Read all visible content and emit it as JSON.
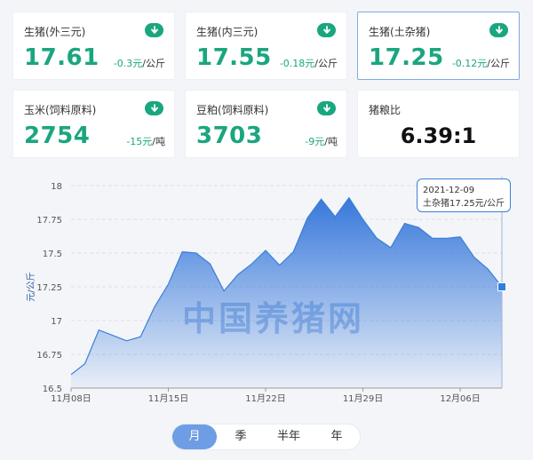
{
  "cards": [
    {
      "label": "生猪(外三元)",
      "value": "17.61",
      "change": "-0.3元",
      "unit": "/公斤",
      "trend": "down"
    },
    {
      "label": "生猪(内三元)",
      "value": "17.55",
      "change": "-0.18元",
      "unit": "/公斤",
      "trend": "down"
    },
    {
      "label": "生猪(土杂猪)",
      "value": "17.25",
      "change": "-0.12元",
      "unit": "/公斤",
      "trend": "down"
    },
    {
      "label": "玉米(饲料原料)",
      "value": "2754",
      "change": "-15元",
      "unit": "/吨",
      "trend": "down"
    },
    {
      "label": "豆粕(饲料原料)",
      "value": "3703",
      "change": "-9元",
      "unit": "/吨",
      "trend": "down"
    },
    {
      "label": "猪粮比",
      "value": "6.39:1"
    }
  ],
  "tooltip": {
    "date": "2021-12-09",
    "text": "土杂猪17.25元/公斤"
  },
  "watermark": "中国养猪网",
  "periods": [
    {
      "label": "月",
      "active": true
    },
    {
      "label": "季",
      "active": false
    },
    {
      "label": "半年",
      "active": false
    },
    {
      "label": "年",
      "active": false
    }
  ],
  "colors": {
    "accent": "#1aa67f",
    "line": "#3b7fd6",
    "marker": "#2f7ee0"
  },
  "chart_data": {
    "type": "area",
    "ylabel": "元/公斤",
    "ylim": [
      16.5,
      18
    ],
    "yticks": [
      "16.5",
      "16.75",
      "17",
      "17.25",
      "17.5",
      "17.75",
      "18"
    ],
    "xtick_labels": [
      "11月08日",
      "11月15日",
      "11月22日",
      "11月29日",
      "12月06日"
    ],
    "grid": true,
    "x": [
      "2021-11-08",
      "2021-11-09",
      "2021-11-10",
      "2021-11-11",
      "2021-11-12",
      "2021-11-13",
      "2021-11-14",
      "2021-11-15",
      "2021-11-16",
      "2021-11-17",
      "2021-11-18",
      "2021-11-19",
      "2021-11-20",
      "2021-11-21",
      "2021-11-22",
      "2021-11-23",
      "2021-11-24",
      "2021-11-25",
      "2021-11-26",
      "2021-11-27",
      "2021-11-28",
      "2021-11-29",
      "2021-11-30",
      "2021-12-01",
      "2021-12-02",
      "2021-12-03",
      "2021-12-04",
      "2021-12-05",
      "2021-12-06",
      "2021-12-07",
      "2021-12-08",
      "2021-12-09"
    ],
    "series": [
      {
        "values": [
          16.6,
          16.68,
          16.93,
          16.89,
          16.85,
          16.88,
          17.1,
          17.27,
          17.51,
          17.5,
          17.42,
          17.22,
          17.34,
          17.42,
          17.52,
          17.41,
          17.51,
          17.76,
          17.9,
          17.77,
          17.91,
          17.75,
          17.61,
          17.54,
          17.72,
          17.69,
          17.61,
          17.61,
          17.62,
          17.47,
          17.38,
          17.25
        ]
      }
    ],
    "highlight": {
      "x": "2021-12-09",
      "y": 17.25
    }
  }
}
